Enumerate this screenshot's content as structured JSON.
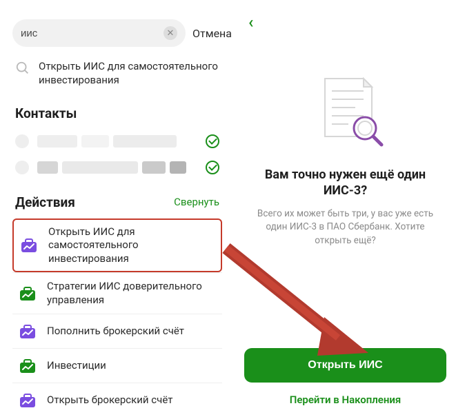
{
  "left": {
    "search": {
      "value": "иис",
      "placeholder": ""
    },
    "cancel": "Отмена",
    "suggestion": "Открыть ИИС для самостоятельного инвестирования",
    "contacts_header": "Контакты",
    "actions_header": "Действия",
    "actions_collapse": "Свернуть",
    "actions": [
      {
        "label": "Открыть ИИС для самостоятельного инвестирования",
        "icon": "briefcase-chart-icon",
        "color": "purple",
        "highlight": true
      },
      {
        "label": "Стратегии ИИС доверительного управления",
        "icon": "briefcase-chart-icon",
        "color": "green",
        "highlight": false
      },
      {
        "label": "Пополнить брокерский счёт",
        "icon": "briefcase-chart-icon",
        "color": "purple",
        "highlight": false
      },
      {
        "label": "Инвестиции",
        "icon": "briefcase-chart-icon",
        "color": "green",
        "highlight": false
      },
      {
        "label": "Открыть брокерский счёт",
        "icon": "briefcase-chart-icon",
        "color": "purple",
        "highlight": false
      }
    ]
  },
  "right": {
    "title": "Вам точно нужен ещё один ИИС-3?",
    "subtitle": "Всего их может быть три, у вас уже есть один ИИС-3 в ПАО Сбербанк. Хотите открыть ещё?",
    "primary": "Открыть ИИС",
    "secondary": "Перейти в Накопления"
  },
  "colors": {
    "accent": "#1a8f1a",
    "highlight_border": "#c53a2a",
    "purple": "#7a4de0"
  }
}
